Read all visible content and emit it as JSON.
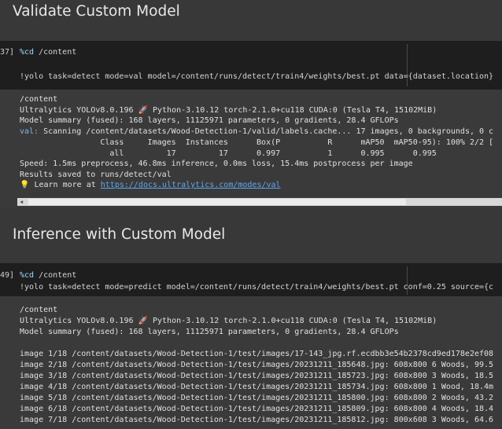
{
  "section1": {
    "heading": "Validate Custom Model",
    "exec_count": "37]",
    "code_line1_magic": "%cd",
    "code_line1_rest": " /content",
    "code_line2": "!yolo task=detect mode=val model=/content/runs/detect/train4/weights/best.pt data={dataset.location}",
    "output": [
      "/content",
      "Ultralytics YOLOv8.0.196 🚀 Python-3.10.12 torch-2.1.0+cu118 CUDA:0 (Tesla T4, 15102MiB)",
      "Model summary (fused): 168 layers, 11125971 parameters, 0 gradients, 28.4 GFLOPs",
      "val: Scanning /content/datasets/Wood-Detection-1/valid/labels.cache... 17 images, 0 backgrounds, 0 c",
      "                 Class     Images  Instances      Box(P          R      mAP50  mAP50-95): 100% 2/2 [",
      "                   all         17         17      0.997          1      0.995      0.995",
      "Speed: 1.5ms preprocess, 46.8ms inference, 0.0ms loss, 15.4ms postprocess per image",
      "Results saved to runs/detect/val"
    ],
    "learn_more": " Learn more at ",
    "link": "https://docs.ultralytics.com/modes/val"
  },
  "section2": {
    "heading": "Inference with Custom Model",
    "exec_count": "49]",
    "code_line1_magic": "%cd",
    "code_line1_rest": " /content",
    "code_line2": "!yolo task=detect mode=predict model=/content/runs/detect/train4/weights/best.pt conf=0.25 source={c",
    "output": [
      "/content",
      "Ultralytics YOLOv8.0.196 🚀 Python-3.10.12 torch-2.1.0+cu118 CUDA:0 (Tesla T4, 15102MiB)",
      "Model summary (fused): 168 layers, 11125971 parameters, 0 gradients, 28.4 GFLOPs",
      "",
      "image 1/18 /content/datasets/Wood-Detection-1/test/images/17-143_jpg.rf.ecdbb3e54b2378cd9ed178e2ef08",
      "image 2/18 /content/datasets/Wood-Detection-1/test/images/20231211_185648.jpg: 608x800 6 Woods, 99.5",
      "image 3/18 /content/datasets/Wood-Detection-1/test/images/20231211_185723.jpg: 608x800 3 Woods, 18.5",
      "image 4/18 /content/datasets/Wood-Detection-1/test/images/20231211_185734.jpg: 608x800 1 Wood, 18.4m",
      "image 5/18 /content/datasets/Wood-Detection-1/test/images/20231211_185800.jpg: 608x800 2 Woods, 43.2",
      "image 6/18 /content/datasets/Wood-Detection-1/test/images/20231211_185809.jpg: 608x800 4 Woods, 18.4",
      "image 7/18 /content/datasets/Wood-Detection-1/test/images/20231211_185812.jpg: 800x608 3 Woods, 64.6"
    ]
  },
  "colors": {
    "page_bg": "#383838",
    "code_bg": "#1e1e1e",
    "link": "#5ea8f0",
    "magic": "#9cdcfe"
  }
}
